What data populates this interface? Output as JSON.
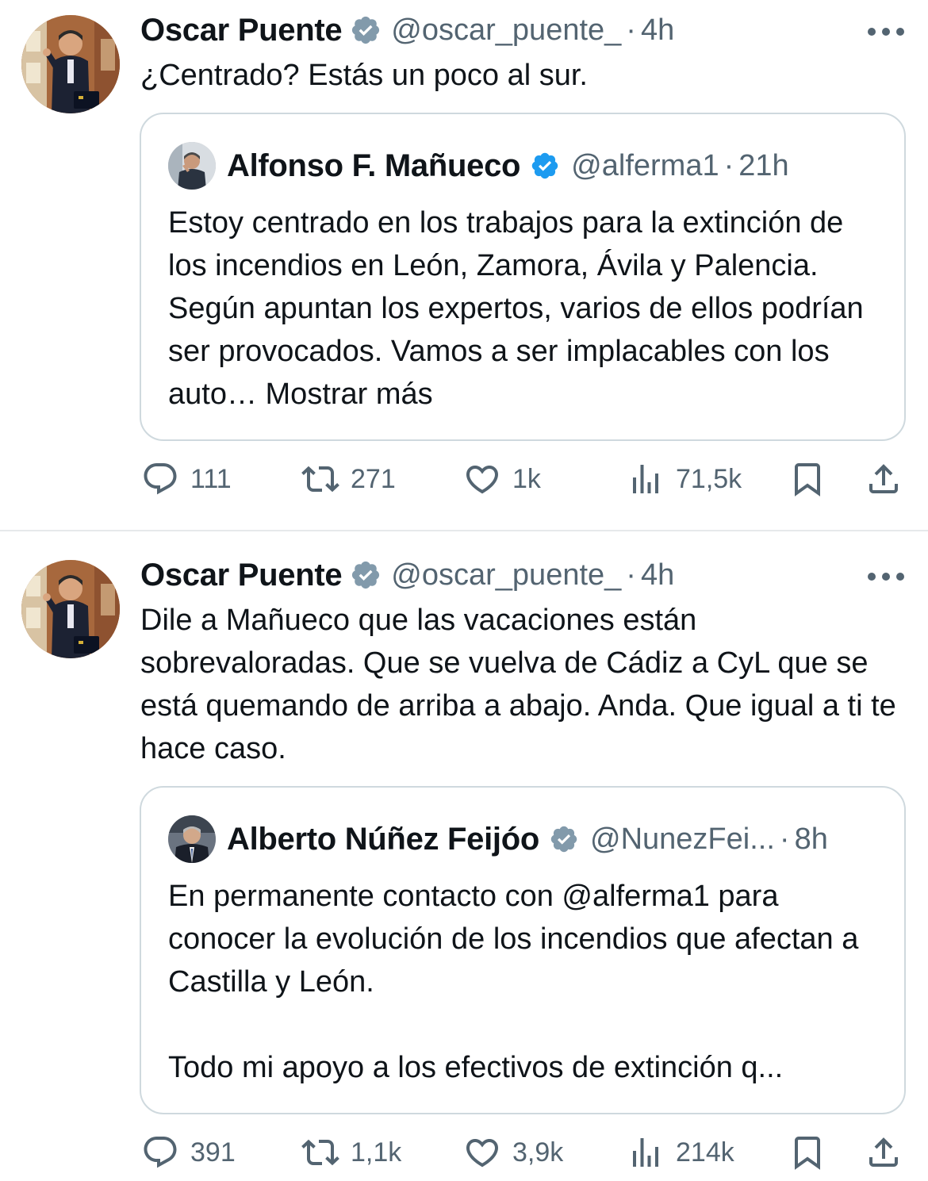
{
  "tweets": [
    {
      "author": {
        "name": "Oscar Puente",
        "handle": "@oscar_puente_",
        "time": "4h"
      },
      "text": "¿Centrado? Estás un poco al sur.",
      "quote": {
        "author": {
          "name": "Alfonso F. Mañueco",
          "handle": "@alferma1",
          "time": "21h"
        },
        "text": "Estoy centrado en los trabajos para la extinción de los incendios en León, Zamora, Ávila y Palencia. Según apuntan los expertos, varios de ellos podrían ser provocados. Vamos a ser implacables con los auto…",
        "more_label": " Mostrar más"
      },
      "stats": {
        "replies": "111",
        "retweets": "271",
        "likes": "1k",
        "views": "71,5k"
      }
    },
    {
      "author": {
        "name": "Oscar Puente",
        "handle": "@oscar_puente_",
        "time": "4h"
      },
      "text": "Dile a Mañueco que las vacaciones están sobrevaloradas. Que se vuelva de Cádiz a CyL que se está quemando de arriba a abajo. Anda. Que igual a ti te hace caso.",
      "quote": {
        "author": {
          "name": "Alberto Núñez Feijóo",
          "handle": "@NunezFei...",
          "time": "8h"
        },
        "text": "En permanente contacto con @alferma1 para conocer la evolución de los incendios que afectan a Castilla y León.\n\nTodo mi apoyo a los efectivos de extinción q...",
        "more_label": ""
      },
      "stats": {
        "replies": "391",
        "retweets": "1,1k",
        "likes": "3,9k",
        "views": "214k"
      }
    }
  ],
  "ui": {
    "separator": "·",
    "icons": {
      "verified": "verified-badge-icon",
      "more": "more-options-icon",
      "reply": "reply-icon",
      "retweet": "retweet-icon",
      "like": "heart-icon",
      "views": "views-chart-icon",
      "bookmark": "bookmark-icon",
      "share": "share-icon"
    },
    "colors": {
      "verified_blue": "#1d9bf0",
      "verified_gray": "#829aab",
      "secondary_text": "#536471",
      "border": "#cfd9de"
    }
  }
}
